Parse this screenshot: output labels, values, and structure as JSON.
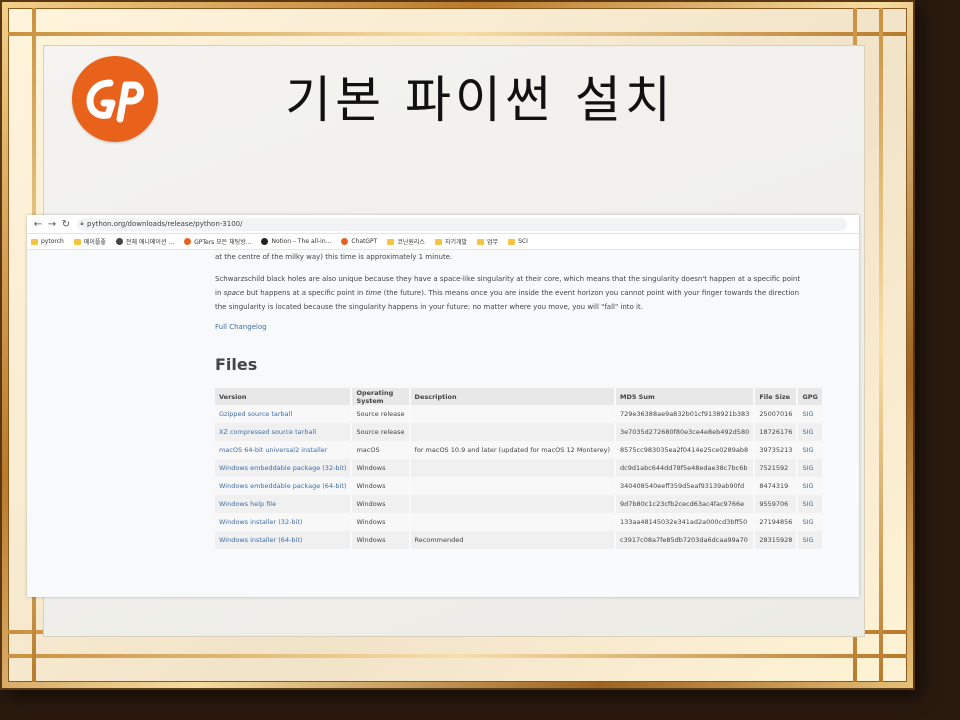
{
  "slide": {
    "title": "기본 파이썬 설치",
    "logo_text": "GP",
    "accent": "#e8621c"
  },
  "browser": {
    "url": "python.org/downloads/release/python-3100/",
    "bookmarks": [
      {
        "label": "pytorch",
        "icon": "folder-icon"
      },
      {
        "label": "메이플좋",
        "icon": "folder-icon"
      },
      {
        "label": "전체 애니메이션 ...",
        "icon": "globe-icon"
      },
      {
        "label": "GPTers 모든 채팅방...",
        "icon": "gpters-icon"
      },
      {
        "label": "Notion – The all-in...",
        "icon": "notion-icon"
      },
      {
        "label": "ChatGPT",
        "icon": "chatgpt-icon"
      },
      {
        "label": "코난원리스",
        "icon": "folder-icon"
      },
      {
        "label": "자기개발",
        "icon": "folder-icon"
      },
      {
        "label": "업무",
        "icon": "folder-icon"
      },
      {
        "label": "SCI",
        "icon": "folder-icon"
      }
    ]
  },
  "page": {
    "para1": "at the centre of the milky way) this time is approximately 1 minute.",
    "para2_a": "Schwarzschild black holes are also unique because they have a space-like singularity at their core, which means that the singularity doesn't happen at a specific point in ",
    "para2_em1": "space",
    "para2_b": " but happens at a specific point in ",
    "para2_em2": "time",
    "para2_c": " (the future). This means once you are inside the event horizon you cannot point with your finger towards the direction the singularity is located because the singularity happens in your future: no matter where you move, you will \"fall\" into it.",
    "changelog_link": "Full Changelog",
    "files_heading": "Files",
    "columns": [
      "Version",
      "Operating System",
      "Description",
      "MD5 Sum",
      "File Size",
      "GPG"
    ],
    "rows": [
      [
        "Gzipped source tarball",
        "Source release",
        "",
        "729e36388ae9a832b01cf9138921b383",
        "25007016",
        "SIG"
      ],
      [
        "XZ compressed source tarball",
        "Source release",
        "",
        "3e7035d272680f80e3ce4e8eb492d580",
        "18726176",
        "SIG"
      ],
      [
        "macOS 64-bit universal2 installer",
        "macOS",
        "for macOS 10.9 and later (updated for macOS 12 Monterey)",
        "8575cc983035ea2f0414e25ce0289ab8",
        "39735213",
        "SIG"
      ],
      [
        "Windows embeddable package (32-bit)",
        "Windows",
        "",
        "dc9d1abc644dd78f5e48edae38c7bc6b",
        "7521592",
        "SIG"
      ],
      [
        "Windows embeddable package (64-bit)",
        "Windows",
        "",
        "340408540eeff359d5eaf93139ab90fd",
        "8474319",
        "SIG"
      ],
      [
        "Windows help file",
        "Windows",
        "",
        "9d7b80c1c23cfb2cecd63ac4fac9766e",
        "9559706",
        "SIG"
      ],
      [
        "Windows installer (32-bit)",
        "Windows",
        "",
        "133aa48145032e341ad2a000cd3bff50",
        "27194856",
        "SIG"
      ],
      [
        "Windows installer (64-bit)",
        "Windows",
        "Recommended",
        "c3917c08a7fe85db7203da6dcaa99a70",
        "28315928",
        "SIG"
      ]
    ]
  }
}
